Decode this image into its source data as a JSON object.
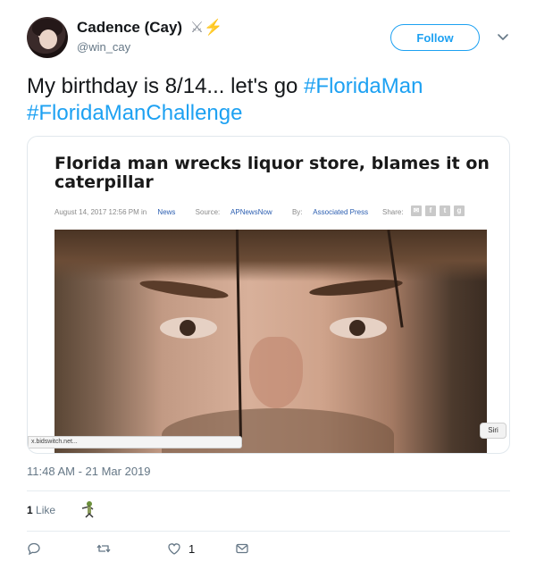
{
  "tweet": {
    "author_name": "Cadence (Cay)",
    "author_emoji": [
      "⚔",
      "⚡"
    ],
    "handle": "@win_cay",
    "follow_label": "Follow",
    "text_plain": "My birthday is 8/14... let's go ",
    "hashtags": [
      "#FloridaMan",
      "#FloridaManChallenge"
    ],
    "timestamp": "11:48 AM - 21 Mar 2019",
    "like_count": "1",
    "like_label": "Like",
    "actions": {
      "reply_icon": "reply-icon",
      "retweet_icon": "retweet-icon",
      "like_icon": "heart-icon",
      "like_count": "1",
      "dm_icon": "envelope-icon"
    }
  },
  "card": {
    "headline": "Florida man wrecks liquor store, blames it on caterpillar",
    "meta": {
      "date": "August 14, 2017 12:56 PM in",
      "category": "News",
      "source_label": "Source:",
      "source": "APNewsNow",
      "by_label": "By:",
      "author": "Associated Press",
      "share_label": "Share:"
    },
    "share_icons": [
      "mail-icon",
      "facebook-icon",
      "twitter-icon",
      "googleplus-icon"
    ],
    "url_bar_text": "x.bidswitch.net...",
    "siri_label": "Siri"
  },
  "colors": {
    "accent": "#1da1f2",
    "text": "#14171a",
    "muted": "#657786",
    "border": "#e1e8ed"
  }
}
